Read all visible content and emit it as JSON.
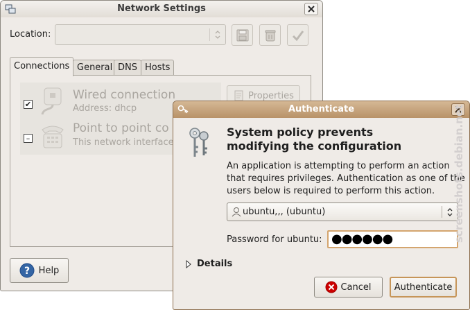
{
  "network_window": {
    "title": "Network Settings",
    "location_label": "Location:",
    "location_value": "",
    "tabs": [
      {
        "label": "Connections",
        "active": true
      },
      {
        "label": "General",
        "active": false
      },
      {
        "label": "DNS",
        "active": false
      },
      {
        "label": "Hosts",
        "active": false
      }
    ],
    "connections": [
      {
        "title": "Wired connection",
        "subtitle": "Address: dhcp",
        "checkbox": "checked"
      },
      {
        "title": "Point to point co",
        "subtitle": "This network interface",
        "checkbox": "mixed"
      }
    ],
    "properties_button": "Properties",
    "help_button": "Help"
  },
  "auth_dialog": {
    "title": "Authenticate",
    "heading_line1": "System policy prevents",
    "heading_line2": "modifying the configuration",
    "message": "An application is attempting to perform an action that requires privileges. Authentication as one of the users below is required to perform this action.",
    "user_value": "ubuntu,,, (ubuntu)",
    "password_label": "Password for ubuntu:",
    "password_mask": "●●●●●●",
    "details_label": "Details",
    "cancel_button": "Cancel",
    "authenticate_button": "Authenticate"
  },
  "watermark": "screenshots.debian.net",
  "colors": {
    "window_bg": "#efebe7",
    "auth_titlebar": "#c7a57f",
    "accent_border": "#d4a56e",
    "disabled_text": "#a9a59f"
  },
  "icons": [
    "network-icon",
    "close-icon",
    "save-icon",
    "delete-icon",
    "apply-check-icon",
    "wired-network-icon",
    "telephone-modem-icon",
    "properties-icon",
    "help-icon",
    "keys-icon",
    "user-icon",
    "combo-arrows-icon",
    "expander-arrow-icon",
    "cancel-icon"
  ]
}
